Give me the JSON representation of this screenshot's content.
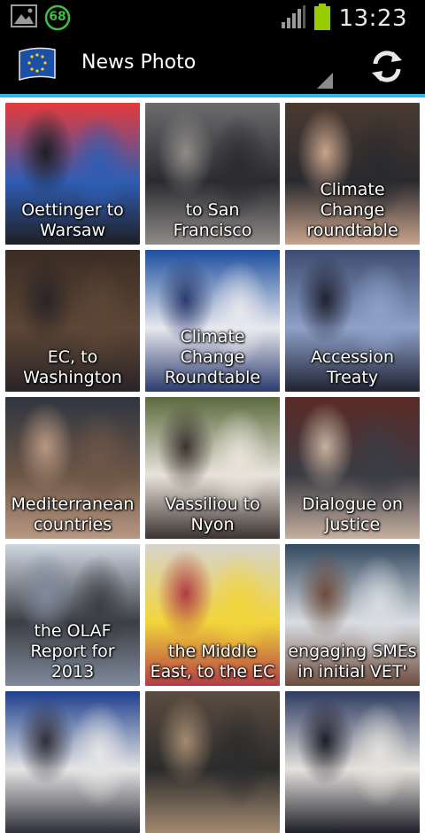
{
  "status_bar": {
    "time": "13:23",
    "notification_count": "68",
    "icons": [
      "image-icon",
      "counter-badge-icon",
      "signal-icon",
      "battery-icon"
    ],
    "battery_color": "#99cc00"
  },
  "action_bar": {
    "title": "News Photo",
    "app_icon": "eu-flag-icon",
    "refresh_icon": "refresh-icon",
    "accent_color": "#33b5e5"
  },
  "tiles": [
    {
      "caption": "Oettinger to Warsaw"
    },
    {
      "caption": "to San Francisco"
    },
    {
      "caption": "Climate Change roundtable"
    },
    {
      "caption": "EC, to Washington"
    },
    {
      "caption": "Climate Change Roundtable"
    },
    {
      "caption": "Accession Treaty"
    },
    {
      "caption": "Mediterranean countries"
    },
    {
      "caption": "Vassiliou to Nyon"
    },
    {
      "caption": "Dialogue on Justice"
    },
    {
      "caption": "the OLAF Report for 2013"
    },
    {
      "caption": "the Middle East, to the EC"
    },
    {
      "caption": "engaging SMEs in initial VET'"
    }
  ],
  "tile_photos": [
    [
      "#e63a3a",
      "#2f5db3",
      "#1f1f24"
    ],
    [
      "#6c6c6e",
      "#2b2b30",
      "#8f8b88"
    ],
    [
      "#4a3a30",
      "#2a2a2e",
      "#c9a48c"
    ],
    [
      "#3a2c24",
      "#5c4636",
      "#2a2426"
    ],
    [
      "#1d4f9e",
      "#e8e8ee",
      "#2b3b6e"
    ],
    [
      "#3d4c6f",
      "#8ea0c8",
      "#1f2332"
    ],
    [
      "#2f3540",
      "#6d5646",
      "#b89882"
    ],
    [
      "#5b6a3f",
      "#e8e3da",
      "#3b3330"
    ],
    [
      "#5b2a26",
      "#3b3c44",
      "#c6b0a0"
    ],
    [
      "#cfd7e2",
      "#3c3e44",
      "#7f8a9c"
    ],
    [
      "#d7d3cb",
      "#f2d53b",
      "#b23b45"
    ],
    [
      "#33485f",
      "#d9dde2",
      "#6d4b3d"
    ],
    [
      "#1e3f8e",
      "#e5e5e5",
      "#2f2f3a"
    ],
    [
      "#5b4c40",
      "#2c2c2c",
      "#a38a70"
    ],
    [
      "#2e3c62",
      "#e5e2dd",
      "#1e1e28"
    ]
  ]
}
